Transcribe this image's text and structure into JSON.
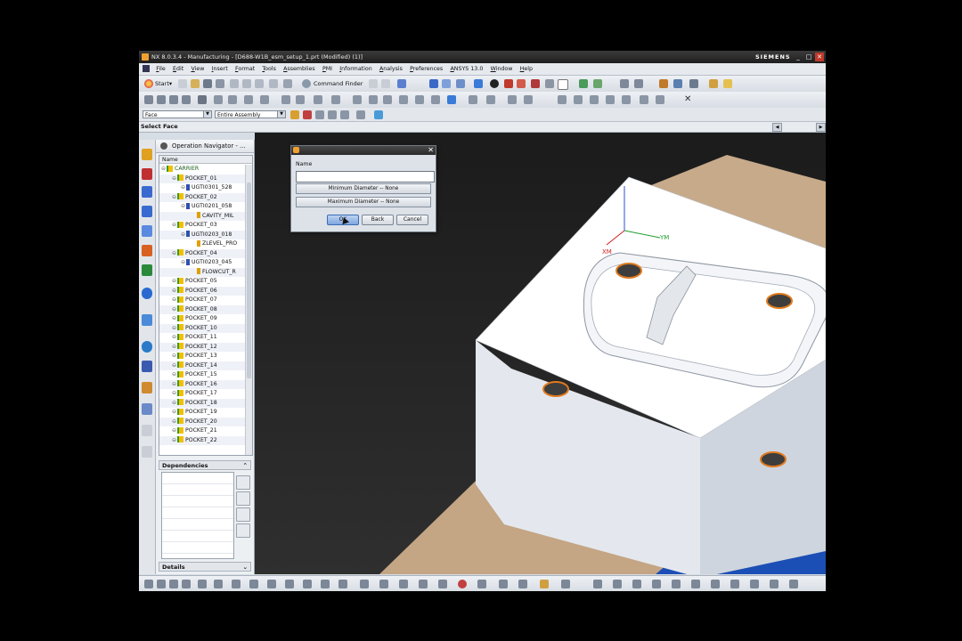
{
  "window": {
    "title": "NX 8.0.3.4 - Manufacturing - [D688-W1B_esm_setup_1.prt (Modified)  (1)]",
    "brand": "SIEMENS",
    "controls": [
      "_",
      "□",
      "✕"
    ]
  },
  "menu": [
    "File",
    "Edit",
    "View",
    "Insert",
    "Format",
    "Tools",
    "Assemblies",
    "PMI",
    "Information",
    "Analysis",
    "Preferences",
    "ANSYS 13.0",
    "Window",
    "Help"
  ],
  "toolbar": {
    "start_label": "Start▾",
    "command_finder_label": "Command Finder"
  },
  "selection_bar": {
    "filter_value": "Face",
    "scope_value": "Entire Assembly"
  },
  "status_prompt": "Select Face",
  "navigator": {
    "title": "Operation Navigator - ...",
    "column_header": "Name",
    "rows": [
      {
        "label": "CARRIER",
        "kind": "root"
      },
      {
        "label": "POCKET_01",
        "kind": "prog"
      },
      {
        "label": "UGTI0301_528",
        "kind": "tool"
      },
      {
        "label": "POCKET_02",
        "kind": "prog"
      },
      {
        "label": "UGTI0201_058",
        "kind": "tool"
      },
      {
        "label": "CAVITY_MIL",
        "kind": "op"
      },
      {
        "label": "POCKET_03",
        "kind": "prog"
      },
      {
        "label": "UGTI0203_018",
        "kind": "tool"
      },
      {
        "label": "ZLEVEL_PRO",
        "kind": "op"
      },
      {
        "label": "POCKET_04",
        "kind": "prog"
      },
      {
        "label": "UGTI0203_045",
        "kind": "tool"
      },
      {
        "label": "FLOWCUT_R",
        "kind": "op"
      },
      {
        "label": "POCKET_05",
        "kind": "prog"
      },
      {
        "label": "POCKET_06",
        "kind": "prog"
      },
      {
        "label": "POCKET_07",
        "kind": "prog"
      },
      {
        "label": "POCKET_08",
        "kind": "prog"
      },
      {
        "label": "POCKET_09",
        "kind": "prog"
      },
      {
        "label": "POCKET_10",
        "kind": "prog"
      },
      {
        "label": "POCKET_11",
        "kind": "prog"
      },
      {
        "label": "POCKET_12",
        "kind": "prog"
      },
      {
        "label": "POCKET_13",
        "kind": "prog"
      },
      {
        "label": "POCKET_14",
        "kind": "prog"
      },
      {
        "label": "POCKET_15",
        "kind": "prog"
      },
      {
        "label": "POCKET_16",
        "kind": "prog"
      },
      {
        "label": "POCKET_17",
        "kind": "prog"
      },
      {
        "label": "POCKET_18",
        "kind": "prog"
      },
      {
        "label": "POCKET_19",
        "kind": "prog"
      },
      {
        "label": "POCKET_20",
        "kind": "prog"
      },
      {
        "label": "POCKET_21",
        "kind": "prog"
      },
      {
        "label": "POCKET_22",
        "kind": "prog"
      }
    ],
    "dependencies_label": "Dependencies",
    "details_label": "Details"
  },
  "dialog": {
    "name_label": "Name",
    "name_value": "",
    "min_diameter": "Minimum Diameter -- None",
    "max_diameter": "Maximum Diameter -- None",
    "ok_label": "OK",
    "back_label": "Back",
    "cancel_label": "Cancel"
  },
  "viewport": {
    "axis_labels": [
      "XM",
      "YM"
    ],
    "colors": {
      "part_face": "#ffffff",
      "part_side": "#d6dbe4",
      "stock": "#c5a988",
      "fixture": "#1c4fb5",
      "hole_rim": "#e07a1e"
    }
  }
}
